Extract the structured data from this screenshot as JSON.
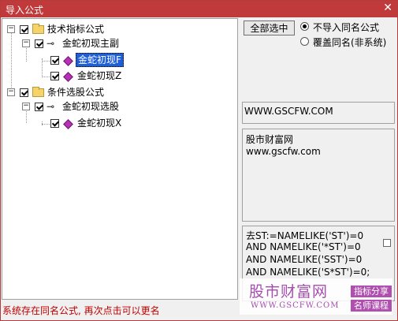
{
  "window": {
    "title": "导入公式",
    "close_glyph": "✕"
  },
  "tree": {
    "nodes": [
      {
        "label": "技术指标公式"
      },
      {
        "label": "金蛇初现主副"
      },
      {
        "label": "金蛇初现F"
      },
      {
        "label": "金蛇初现Z"
      },
      {
        "label": "条件选股公式"
      },
      {
        "label": "金蛇初现选股"
      },
      {
        "label": "金蛇初现X"
      }
    ],
    "expander_glyph": "−"
  },
  "buttons": {
    "select_all": "全部选中"
  },
  "options": {
    "skip_same_name": "不导入同名公式",
    "overwrite_same_name": "覆盖同名(非系统)"
  },
  "panel_url": "WWW.GSCFW.COM",
  "description": {
    "line1": "股市财富网",
    "line2": "www.gscfw.com"
  },
  "code": {
    "line1": "去ST:=NAMELIKE('ST')=0",
    "line2": "AND NAMELIKE('*ST')=0",
    "line3": "AND NAMELIKE('SST')=0",
    "line4": "AND NAMELIKE('S*ST')=0;"
  },
  "status": "系统存在同名公式, 再次点击可以更名",
  "watermark": {
    "name": "股市财富网",
    "url": "WWW.GSCFW.COM",
    "tag1": "指标分享",
    "tag2": "名师课程"
  },
  "colors": {
    "title_bar": "#c0393b",
    "selection": "#1f5fd6",
    "status_text": "#c00000",
    "watermark": "#a64db0"
  }
}
